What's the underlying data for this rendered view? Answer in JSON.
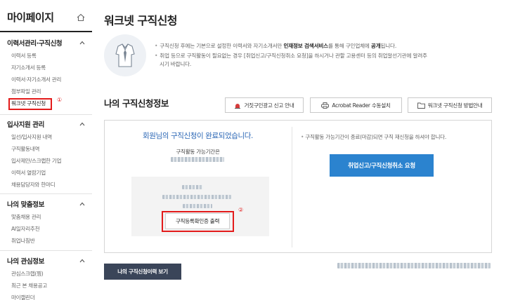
{
  "sidebar": {
    "title": "마이페이지",
    "sections": [
      {
        "title": "이력서관리·구직신청",
        "items": [
          "이력서 등록",
          "자기소개서 등록",
          "이력서·자기소개서 관리",
          "첨부파일 관리",
          "워크넷 구직신청"
        ]
      },
      {
        "title": "입사지원 관리",
        "items": [
          "일선/입사지원 내역",
          "구직활동내역",
          "입사제안/스크랩한 기업",
          "이력서 열람기업",
          "채용담당자와 한마디"
        ]
      },
      {
        "title": "나의 맞춤정보",
        "items": [
          "맞춤채용 관리",
          "AI일자리추천",
          "취업나침반"
        ]
      },
      {
        "title": "나의 관심정보",
        "items": [
          "관심스크랩(찜)",
          "최근 본 채용공고",
          "마이캘린더"
        ]
      }
    ]
  },
  "markers": {
    "first": "①",
    "second": "②"
  },
  "page": {
    "title": "워크넷 구직신청",
    "notice1_pre": "구직신청 후에는 기본으로 설정한 이력서와 자기소개서만 ",
    "notice1_bold": "인재정보 검색서비스",
    "notice1_mid": "를 통해 구인업체에 ",
    "notice1_bold2": "공개",
    "notice1_post": "됩니다.",
    "notice2_line1": "취업 등으로 구직활동이 필요없는 경우 [취업신고/구직신청취소 요청]을 하시거나 관할 고용센터 등의 취업알선기관에 알려주",
    "notice2_line2": "시기 바랍니다."
  },
  "section": {
    "title": "나의 구직신청정보",
    "buttons": [
      "거짓구인광고 신고 안내",
      "Acrobat Reader 수동설치",
      "워크넷 구직신청 방법안내"
    ]
  },
  "status": {
    "complete_msg": "회원님의 구직신청이 완료되었습니다.",
    "period_label": "구직활동 가능기간은",
    "print_button": "구직등록확인증 출력",
    "right_notice": "구직활동 가능기간이 종료(마감)되면 구직 재신청을 하셔야 합니다.",
    "cancel_button": "취업신고/구직신청취소 요청"
  },
  "history_button": "나의 구직신청이력 보기",
  "colors": {
    "accent": "#2b83cf",
    "highlight": "#e31b1b",
    "navy": "#3a4559",
    "message_blue": "#2a66b5"
  }
}
